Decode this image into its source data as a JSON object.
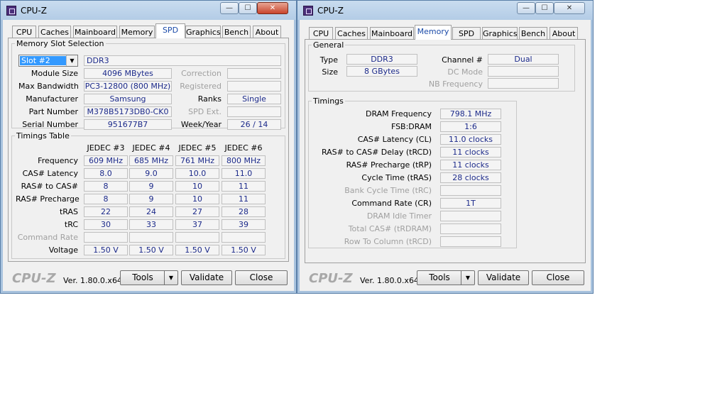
{
  "left": {
    "title": "CPU-Z",
    "tabs": [
      "CPU",
      "Caches",
      "Mainboard",
      "Memory",
      "SPD",
      "Graphics",
      "Bench",
      "About"
    ],
    "active_tab": "SPD",
    "slot_group": "Memory Slot Selection",
    "slot_value": "Slot #2",
    "mem_type": "DDR3",
    "module_size_label": "Module Size",
    "module_size": "4096 MBytes",
    "max_bw_label": "Max Bandwidth",
    "max_bw": "PC3-12800 (800 MHz)",
    "manufacturer_label": "Manufacturer",
    "manufacturer": "Samsung",
    "part_label": "Part Number",
    "part": "M378B5173DB0-CK0",
    "serial_label": "Serial Number",
    "serial": "951677B7",
    "correction_label": "Correction",
    "correction": "",
    "registered_label": "Registered",
    "registered": "",
    "ranks_label": "Ranks",
    "ranks": "Single",
    "spdext_label": "SPD Ext.",
    "spdext": "",
    "weekyear_label": "Week/Year",
    "weekyear": "26 / 14",
    "timings_group": "Timings Table",
    "jedec_headers": [
      "JEDEC #3",
      "JEDEC #4",
      "JEDEC #5",
      "JEDEC #6"
    ],
    "timing_rows": [
      {
        "label": "Frequency",
        "values": [
          "609 MHz",
          "685 MHz",
          "761 MHz",
          "800 MHz"
        ]
      },
      {
        "label": "CAS# Latency",
        "values": [
          "8.0",
          "9.0",
          "10.0",
          "11.0"
        ]
      },
      {
        "label": "RAS# to CAS#",
        "values": [
          "8",
          "9",
          "10",
          "11"
        ]
      },
      {
        "label": "RAS# Precharge",
        "values": [
          "8",
          "9",
          "10",
          "11"
        ]
      },
      {
        "label": "tRAS",
        "values": [
          "22",
          "24",
          "27",
          "28"
        ]
      },
      {
        "label": "tRC",
        "values": [
          "30",
          "33",
          "37",
          "39"
        ]
      },
      {
        "label": "Command Rate",
        "values": [
          "",
          "",
          "",
          ""
        ]
      },
      {
        "label": "Voltage",
        "values": [
          "1.50 V",
          "1.50 V",
          "1.50 V",
          "1.50 V"
        ]
      }
    ],
    "footer": {
      "logo": "CPU-Z",
      "version": "Ver. 1.80.0.x64",
      "tools": "Tools",
      "validate": "Validate",
      "close": "Close"
    }
  },
  "right": {
    "title": "CPU-Z",
    "tabs": [
      "CPU",
      "Caches",
      "Mainboard",
      "Memory",
      "SPD",
      "Graphics",
      "Bench",
      "About"
    ],
    "active_tab": "Memory",
    "general_group": "General",
    "type_label": "Type",
    "type": "DDR3",
    "size_label": "Size",
    "size": "8 GBytes",
    "channel_label": "Channel #",
    "channel": "Dual",
    "dcmode_label": "DC Mode",
    "dcmode": "",
    "nbfreq_label": "NB Frequency",
    "nbfreq": "",
    "timings_group": "Timings",
    "timings": [
      {
        "label": "DRAM Frequency",
        "value": "798.1 MHz",
        "disabled": false
      },
      {
        "label": "FSB:DRAM",
        "value": "1:6",
        "disabled": false
      },
      {
        "label": "CAS# Latency (CL)",
        "value": "11.0 clocks",
        "disabled": false
      },
      {
        "label": "RAS# to CAS# Delay (tRCD)",
        "value": "11 clocks",
        "disabled": false
      },
      {
        "label": "RAS# Precharge (tRP)",
        "value": "11 clocks",
        "disabled": false
      },
      {
        "label": "Cycle Time (tRAS)",
        "value": "28 clocks",
        "disabled": false
      },
      {
        "label": "Bank Cycle Time (tRC)",
        "value": "",
        "disabled": true
      },
      {
        "label": "Command Rate (CR)",
        "value": "1T",
        "disabled": false
      },
      {
        "label": "DRAM Idle Timer",
        "value": "",
        "disabled": true
      },
      {
        "label": "Total CAS# (tRDRAM)",
        "value": "",
        "disabled": true
      },
      {
        "label": "Row To Column (tRCD)",
        "value": "",
        "disabled": true
      }
    ],
    "footer": {
      "logo": "CPU-Z",
      "version": "Ver. 1.80.0.x64",
      "tools": "Tools",
      "validate": "Validate",
      "close": "Close"
    }
  },
  "window_buttons": {
    "minimize": "—",
    "maximize": "☐",
    "close": "✕"
  },
  "colors": {
    "value_text": "#1c2a8a",
    "active_tab_text": "#1a4aa8",
    "title_bar": "#b3cce6"
  }
}
